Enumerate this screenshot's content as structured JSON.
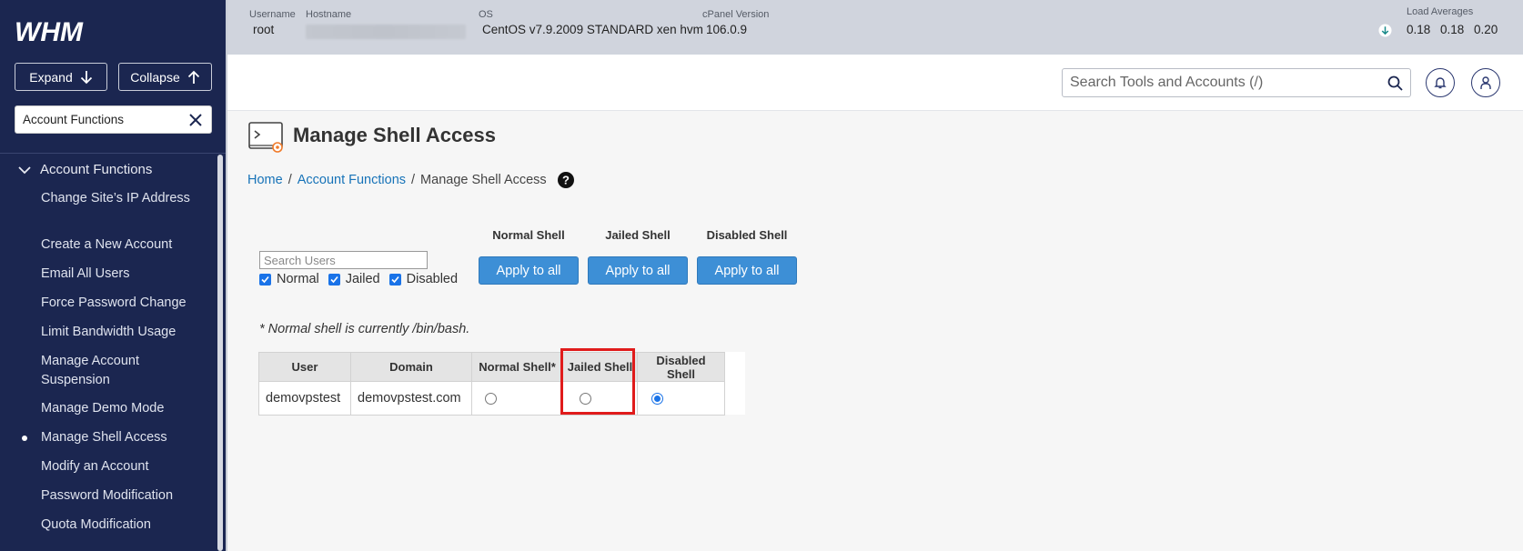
{
  "sidebar": {
    "logo_text": "WHM",
    "expand_label": "Expand",
    "collapse_label": "Collapse",
    "search_value": "Account Functions",
    "group_label": "Account Functions",
    "items": [
      {
        "label": "Change Site’s IP Address"
      },
      {
        "label": "Create a New Account"
      },
      {
        "label": "Email All Users"
      },
      {
        "label": "Force Password Change"
      },
      {
        "label": "Limit Bandwidth Usage"
      },
      {
        "label": "Manage Account Suspension"
      },
      {
        "label": "Manage Demo Mode"
      },
      {
        "label": "Manage Shell Access",
        "active": true
      },
      {
        "label": "Modify an Account"
      },
      {
        "label": "Password Modification"
      },
      {
        "label": "Quota Modification"
      }
    ]
  },
  "topbar": {
    "username_label": "Username",
    "username": "root",
    "hostname_label": "Hostname",
    "os_label": "OS",
    "os": "CentOS v7.9.2009 STANDARD xen hvm",
    "cpanel_label": "cPanel Version",
    "cpanel_version": "106.0.9",
    "load_label": "Load Averages",
    "loads": [
      "0.18",
      "0.18",
      "0.20"
    ]
  },
  "header": {
    "search_placeholder": "Search Tools and Accounts (/)"
  },
  "page": {
    "title": "Manage Shell Access",
    "breadcrumb": {
      "home": "Home",
      "section": "Account Functions",
      "current": "Manage Shell Access"
    },
    "search_users_placeholder": "Search Users",
    "filters": {
      "normal": "Normal",
      "jailed": "Jailed",
      "disabled": "Disabled"
    },
    "bulk": {
      "normal_head": "Normal Shell",
      "jailed_head": "Jailed Shell",
      "disabled_head": "Disabled Shell",
      "apply_label": "Apply to all"
    },
    "note": "* Normal shell is currently /bin/bash.",
    "table": {
      "headers": [
        "User",
        "Domain",
        "Normal Shell*",
        "Jailed Shell",
        "Disabled Shell"
      ],
      "rows": [
        {
          "user": "demovpstest",
          "domain": "demovpstest.com",
          "selected": "Disabled Shell"
        }
      ]
    }
  },
  "colors": {
    "sidebar_bg": "#1b2650",
    "accent": "#3d8fd6",
    "link": "#1773b8",
    "highlight": "#e01b1b"
  }
}
